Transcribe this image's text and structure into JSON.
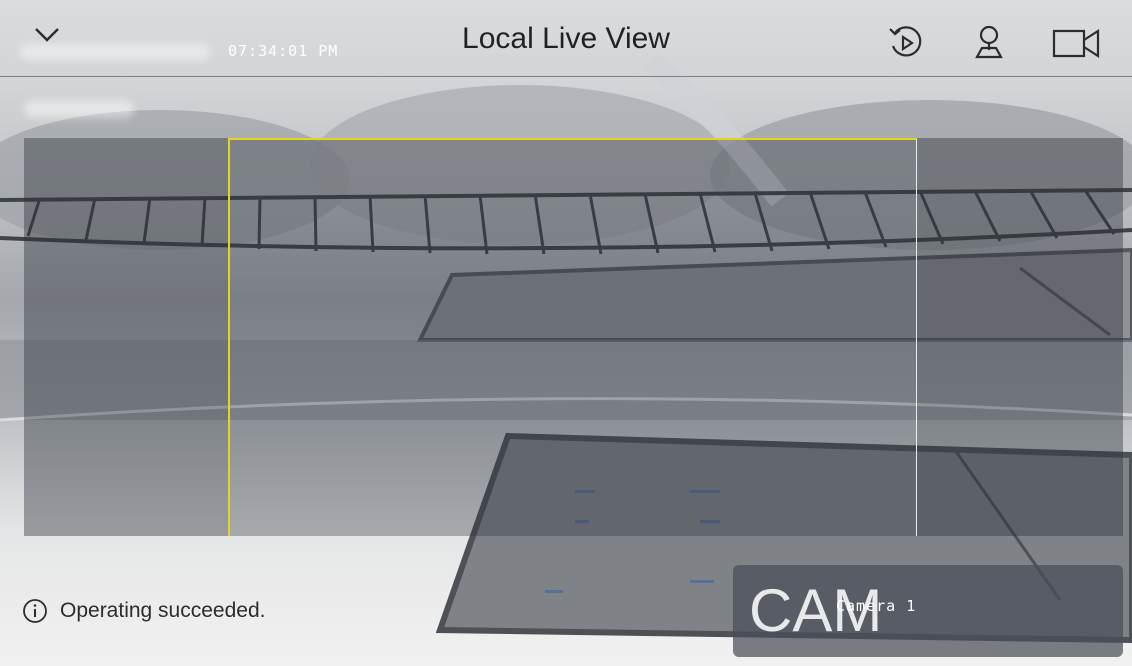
{
  "header": {
    "title": "Local Live View",
    "osd_time": "07:34:01 PM"
  },
  "status": {
    "message": "Operating succeeded."
  },
  "camera_card": {
    "badge": "CAM",
    "name": "Camera 1"
  },
  "colors": {
    "roi_border": "#e2d51a"
  }
}
